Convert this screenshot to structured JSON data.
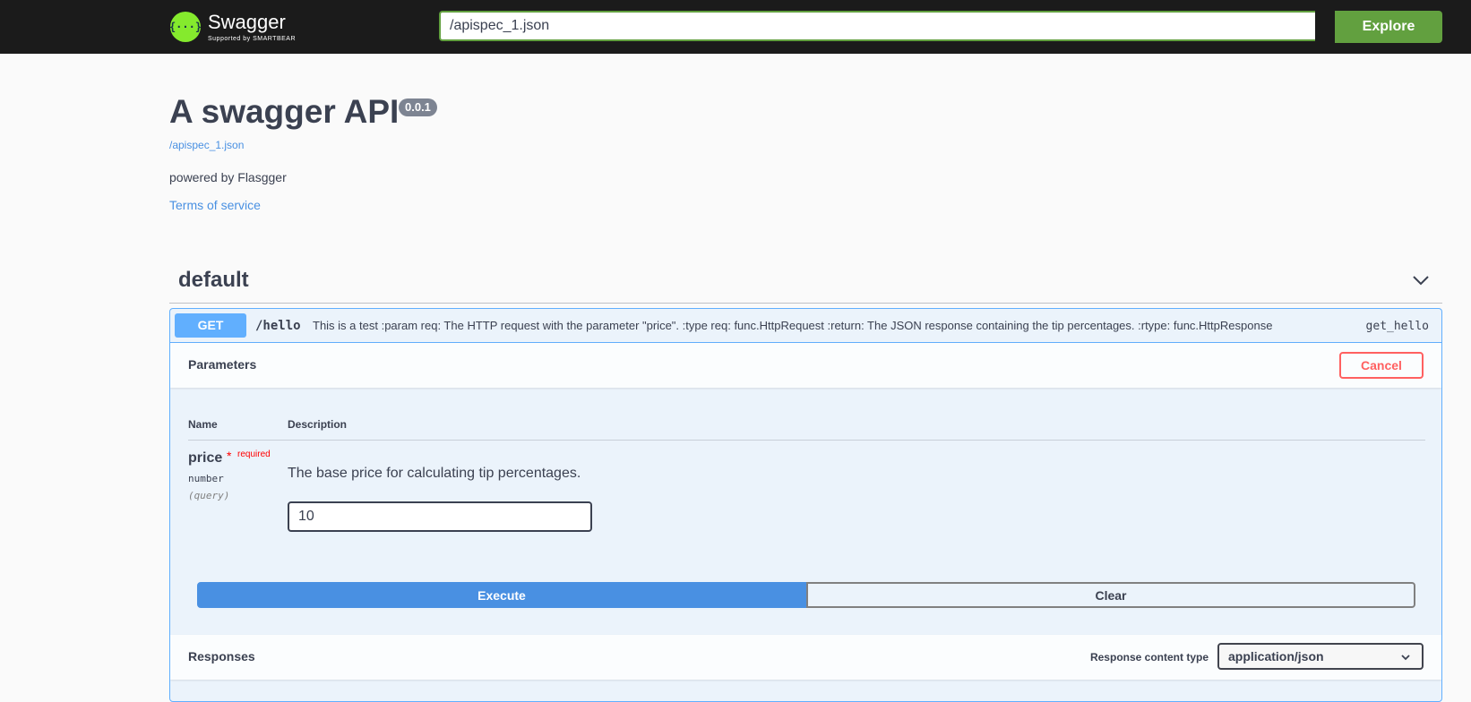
{
  "header": {
    "logo_name": "Swagger",
    "logo_sub": "Supported by SMARTBEAR",
    "logo_glyph": "{···}",
    "url_value": "/apispec_1.json",
    "explore_label": "Explore"
  },
  "info": {
    "title": "A swagger API",
    "version": "0.0.1",
    "spec_link": "/apispec_1.json",
    "description": "powered by Flasgger",
    "terms_link": "Terms of service"
  },
  "tag": {
    "name": "default"
  },
  "operation": {
    "method": "GET",
    "path": "/hello",
    "summary": "This is a test :param req: The HTTP request with the parameter \"price\". :type req: func.HttpRequest :return: The JSON response containing the tip percentages. :rtype: func.HttpResponse",
    "operation_id": "get_hello",
    "parameters_title": "Parameters",
    "cancel_label": "Cancel",
    "col_name": "Name",
    "col_description": "Description",
    "parameter": {
      "name": "price",
      "required_star": "*",
      "required_label": "required",
      "type": "number",
      "in": "(query)",
      "description": "The base price for calculating tip percentages.",
      "value": "10"
    },
    "execute_label": "Execute",
    "clear_label": "Clear",
    "responses_title": "Responses",
    "response_content_type_label": "Response content type",
    "response_content_type_value": "application/json"
  },
  "colors": {
    "topbar": "#1b1b1b",
    "brand_green": "#62a03f",
    "get_blue": "#61affe",
    "execute_blue": "#4990e2",
    "cancel_red": "#ff6060"
  }
}
